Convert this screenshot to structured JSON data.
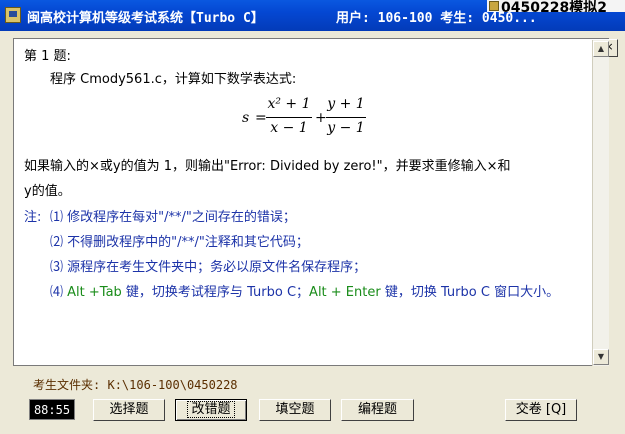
{
  "window": {
    "title": "闽高校计算机等级考试系统【Turbo C】",
    "user_info": "用户: 106-100 考生: 0450...",
    "overlay_text": "0450228模拟2",
    "buttons": {
      "minimize": "_",
      "maximize": "□",
      "close": "×"
    }
  },
  "question": {
    "number": "第 1 题:",
    "intro": "程序 Cmody561.c，计算如下数学表达式:",
    "formula": {
      "lhs": "s",
      "eq": "=",
      "term1_num": "x² + 1",
      "term1_den": "x − 1",
      "plus": "+",
      "term2_num": "y + 1",
      "term2_den": "y − 1"
    },
    "condition_line1": "如果输入的×或y的值为 1，则输出\"Error: Divided by zero!\"，并要求重修输入×和",
    "condition_line2": "y的值。",
    "notes_label": "注:",
    "notes": [
      "⑴ 修改程序在每对\"/**/\"之间存在的错误；",
      "⑵ 不得删改程序中的\"/**/\"注释和其它代码；",
      "⑶ 源程序在考生文件夹中；务必以原文件名保存程序；"
    ],
    "note4": {
      "num": "⑷",
      "key1": "Alt +Tab",
      "text1": " 键，切换考试程序与 ",
      "tc1": "Turbo C",
      "sep": "；",
      "key2": "Alt + Enter",
      "text2": " 键，切换 ",
      "tc2": "Turbo C",
      "text3": " 窗口大小。"
    }
  },
  "status": {
    "folder_label": "考生文件夹:",
    "folder_path": "K:\\106-100\\0450228"
  },
  "toolbar": {
    "timer": "88:55",
    "choice": "选择题",
    "fix": "改错题",
    "fill": "填空题",
    "program": "编程题",
    "submit": "交卷 [Q]"
  },
  "scroll": {
    "up": "▲",
    "down": "▼"
  },
  "colors": {
    "title_bar": "#0447d2",
    "note_blue": "#1c33a8",
    "key_green": "#1a8c1a",
    "timer_bg": "#000000"
  }
}
